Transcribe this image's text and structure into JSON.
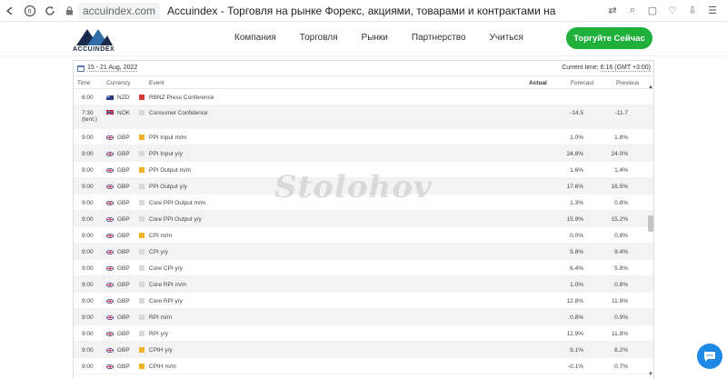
{
  "browser": {
    "url": "accuindex.com",
    "page_title": "Accuindex - Торговля на рынке Форекс, акциями, товарами и контрактами на разницу цен с рег..."
  },
  "site": {
    "logo_text": "ACCUINDEX",
    "nav": [
      "Компания",
      "Торговля",
      "Рынки",
      "Партнерство",
      "Учиться"
    ],
    "cta": "Торгуйте Сейчас",
    "brand_green": "#1fb03b"
  },
  "calendar": {
    "date_range": "15 - 21 Aug, 2022",
    "current_time_label": "Current time:",
    "current_time_value": "6:16 (GMT +3:00)",
    "headers": {
      "time": "Time",
      "currency": "Currency",
      "event": "Event",
      "actual": "Actual",
      "forecast": "Forecast",
      "previous": "Previous"
    },
    "rows": [
      {
        "time": "6:00",
        "flag": "nz-flag-icon",
        "currency": "NZD",
        "importance": "red",
        "event": "RBNZ Press Conference",
        "actual": "",
        "forecast": "",
        "previous": ""
      },
      {
        "time": "7:30 (tent.)",
        "flag": "no-flag-icon",
        "currency": "NOK",
        "importance": "grey",
        "event": "Consumer Confidence",
        "actual": "",
        "forecast": "-14.5",
        "previous": "-11.7"
      },
      {
        "time": "9:00",
        "flag": "gb-flag-icon",
        "currency": "GBP",
        "importance": "orange",
        "event": "PPI Input m/m",
        "actual": "",
        "forecast": "1.0%",
        "previous": "1.8%"
      },
      {
        "time": "9:00",
        "flag": "gb-flag-icon",
        "currency": "GBP",
        "importance": "grey",
        "event": "PPI Input y/y",
        "actual": "",
        "forecast": "24.8%",
        "previous": "24.0%"
      },
      {
        "time": "9:00",
        "flag": "gb-flag-icon",
        "currency": "GBP",
        "importance": "orange",
        "event": "PPI Output m/m",
        "actual": "",
        "forecast": "1.6%",
        "previous": "1.4%"
      },
      {
        "time": "9:00",
        "flag": "gb-flag-icon",
        "currency": "GBP",
        "importance": "grey",
        "event": "PPI Output y/y",
        "actual": "",
        "forecast": "17.6%",
        "previous": "16.5%"
      },
      {
        "time": "9:00",
        "flag": "gb-flag-icon",
        "currency": "GBP",
        "importance": "grey",
        "event": "Core PPI Output m/m",
        "actual": "",
        "forecast": "1.3%",
        "previous": "0.8%"
      },
      {
        "time": "9:00",
        "flag": "gb-flag-icon",
        "currency": "GBP",
        "importance": "grey",
        "event": "Core PPI Output y/y",
        "actual": "",
        "forecast": "15.9%",
        "previous": "15.2%"
      },
      {
        "time": "9:00",
        "flag": "gb-flag-icon",
        "currency": "GBP",
        "importance": "orange",
        "event": "CPI m/m",
        "actual": "",
        "forecast": "0.0%",
        "previous": "0.8%"
      },
      {
        "time": "9:00",
        "flag": "gb-flag-icon",
        "currency": "GBP",
        "importance": "grey",
        "event": "CPI y/y",
        "actual": "",
        "forecast": "9.8%",
        "previous": "9.4%"
      },
      {
        "time": "9:00",
        "flag": "gb-flag-icon",
        "currency": "GBP",
        "importance": "grey",
        "event": "Core CPI y/y",
        "actual": "",
        "forecast": "6.4%",
        "previous": "5.8%"
      },
      {
        "time": "9:00",
        "flag": "gb-flag-icon",
        "currency": "GBP",
        "importance": "grey",
        "event": "Core RPI m/m",
        "actual": "",
        "forecast": "1.0%",
        "previous": "0.8%"
      },
      {
        "time": "9:00",
        "flag": "gb-flag-icon",
        "currency": "GBP",
        "importance": "grey",
        "event": "Core RPI y/y",
        "actual": "",
        "forecast": "12.8%",
        "previous": "11.9%"
      },
      {
        "time": "9:00",
        "flag": "gb-flag-icon",
        "currency": "GBP",
        "importance": "grey",
        "event": "RPI m/m",
        "actual": "",
        "forecast": "0.8%",
        "previous": "0.9%"
      },
      {
        "time": "9:00",
        "flag": "gb-flag-icon",
        "currency": "GBP",
        "importance": "grey",
        "event": "RPI y/y",
        "actual": "",
        "forecast": "12.9%",
        "previous": "11.8%"
      },
      {
        "time": "9:00",
        "flag": "gb-flag-icon",
        "currency": "GBP",
        "importance": "orange",
        "event": "CPIH y/y",
        "actual": "",
        "forecast": "9.1%",
        "previous": "8.2%"
      },
      {
        "time": "9:00",
        "flag": "gb-flag-icon",
        "currency": "GBP",
        "importance": "orange",
        "event": "CPIH m/m",
        "actual": "",
        "forecast": "-0.1%",
        "previous": "0.7%"
      }
    ]
  },
  "watermark": "Stolohov"
}
